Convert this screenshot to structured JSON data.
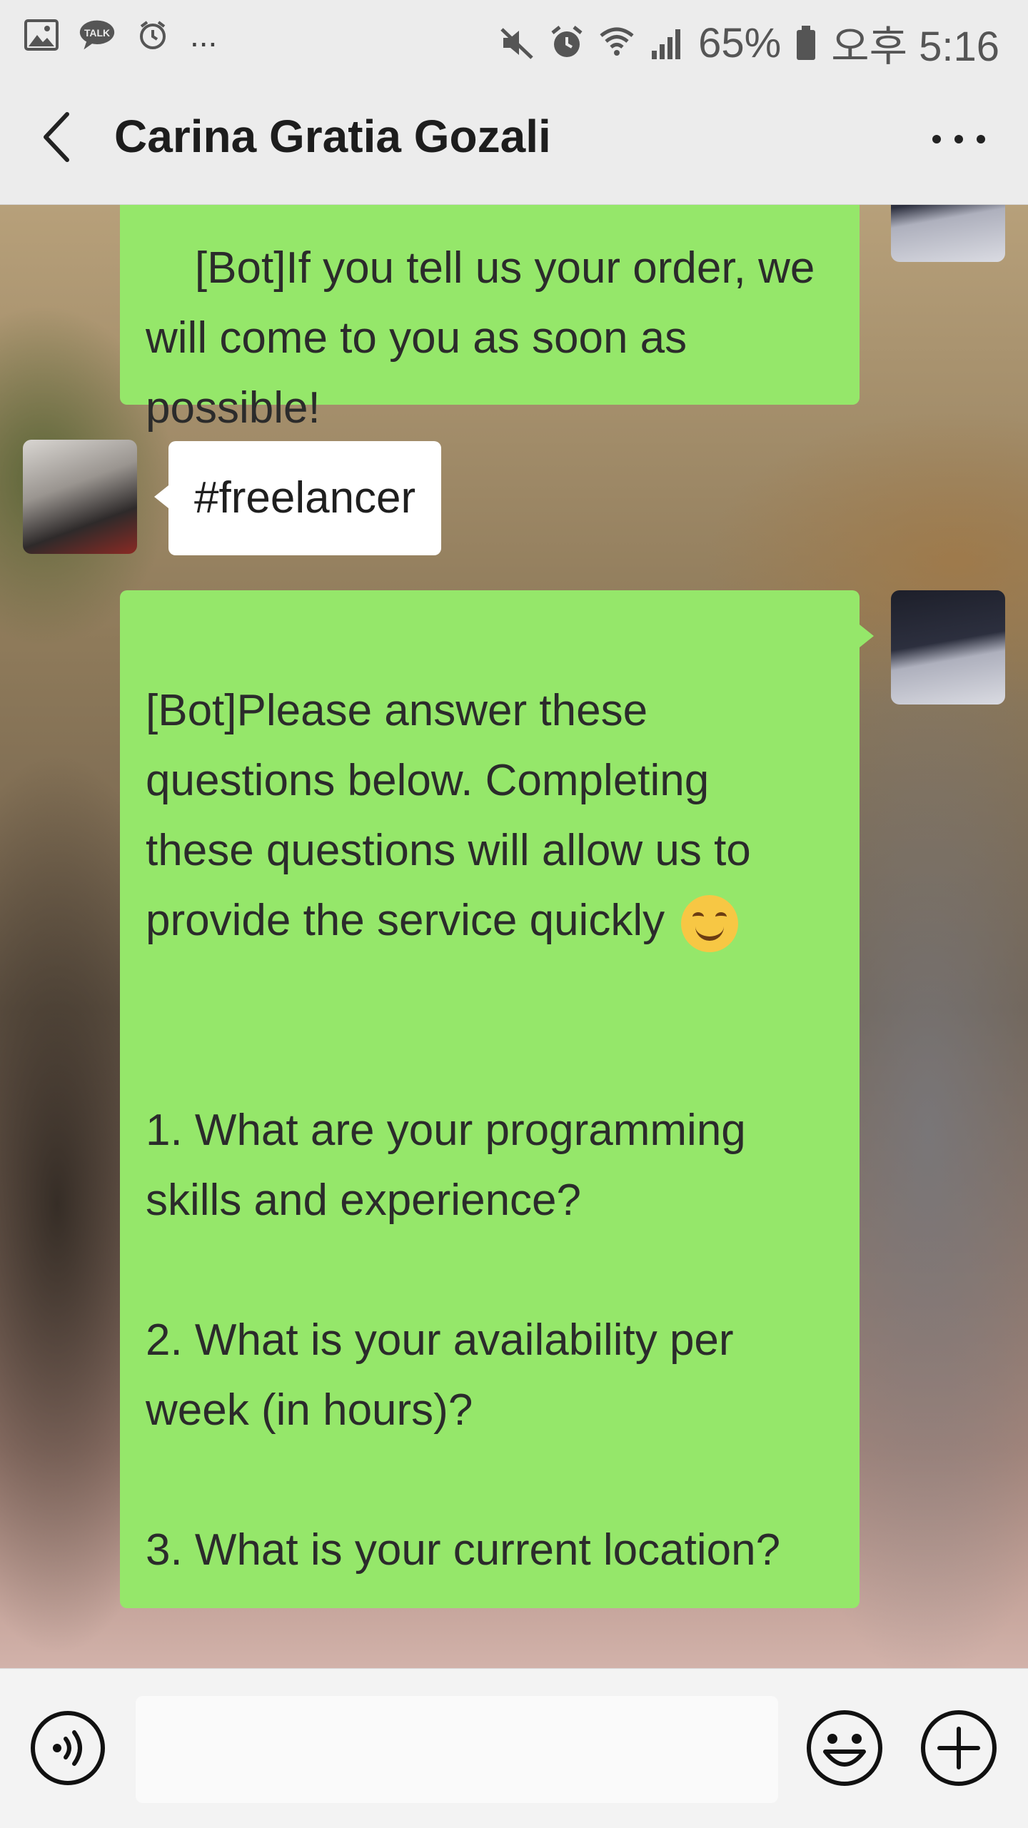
{
  "status_bar": {
    "left_icons": [
      "gallery-icon",
      "talk-icon",
      "alarm-clock-icon",
      "more-notifications-icon"
    ],
    "right_icons": [
      "mute-icon",
      "alarm-icon",
      "wifi-icon",
      "signal-icon",
      "battery-icon"
    ],
    "battery": "65%",
    "time": "오후 5:16",
    "ellipsis": "..."
  },
  "header": {
    "title": "Carina Gratia Gozali",
    "back_icon": "chevron-left-icon",
    "menu_icon": "more-dots-icon"
  },
  "messages": [
    {
      "sender": "me",
      "text": "[Bot]If you tell us your order, we\nwill come to you as soon as\npossible!"
    },
    {
      "sender": "contact",
      "text": "#freelancer"
    },
    {
      "sender": "me",
      "text_before_emoji": "\n[Bot]Please answer these\nquestions below. Completing\nthese questions will allow us to\nprovide the service quickly ",
      "emoji": "smiling-face-emoji",
      "text_after_emoji": "\n\n\n1. What are your programming\nskills and experience?\n\n2. What is your availability per\nweek (in hours)?\n\n3. What is your current location?"
    }
  ],
  "input_bar": {
    "voice_icon": "voice-icon",
    "input_value": "",
    "emoji_icon": "emoji-icon",
    "plus_icon": "plus-icon"
  },
  "colors": {
    "my_bubble": "#95e76a",
    "contact_bubble": "#ffffff",
    "header_bg": "#ececec"
  }
}
